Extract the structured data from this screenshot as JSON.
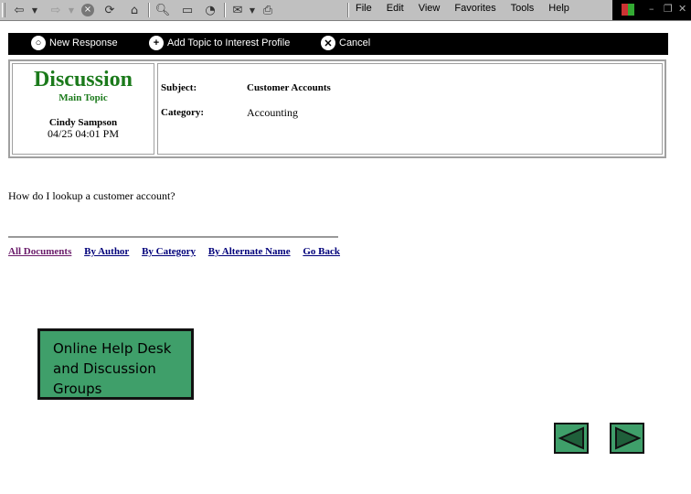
{
  "browser": {
    "toolbar_icons": [
      "back-icon",
      "forward-icon",
      "stop-icon",
      "refresh-icon",
      "home-icon",
      "search-icon",
      "favorites-icon",
      "history-icon",
      "mail-icon",
      "print-icon"
    ],
    "menu": [
      "File",
      "Edit",
      "View",
      "Favorites",
      "Tools",
      "Help"
    ],
    "window_controls": [
      "minimize",
      "restore",
      "close"
    ]
  },
  "actions": [
    {
      "label": "New Response",
      "icon": "speech-bubble-icon"
    },
    {
      "label": "Add Topic to Interest Profile",
      "icon": "plus-icon"
    },
    {
      "label": "Cancel",
      "icon": "cancel-icon"
    }
  ],
  "document": {
    "title": "Discussion",
    "subtitle": "Main Topic",
    "author": "Cindy Sampson",
    "date": "04/25 04:01 PM",
    "subject_label": "Subject:",
    "subject_value": "Customer Accounts",
    "category_label": "Category:",
    "category_value": "Accounting",
    "body": "How do I lookup a customer account?"
  },
  "views": [
    "All Documents",
    "By Author",
    "By Category",
    "By Alternate Name",
    "Go Back"
  ],
  "caption": "Online Help Desk and Discussion Groups",
  "colors": {
    "green": "#3f9f6a",
    "title_green": "#1b7a1b",
    "link": "#00007a",
    "visited": "#6a1b6a"
  }
}
